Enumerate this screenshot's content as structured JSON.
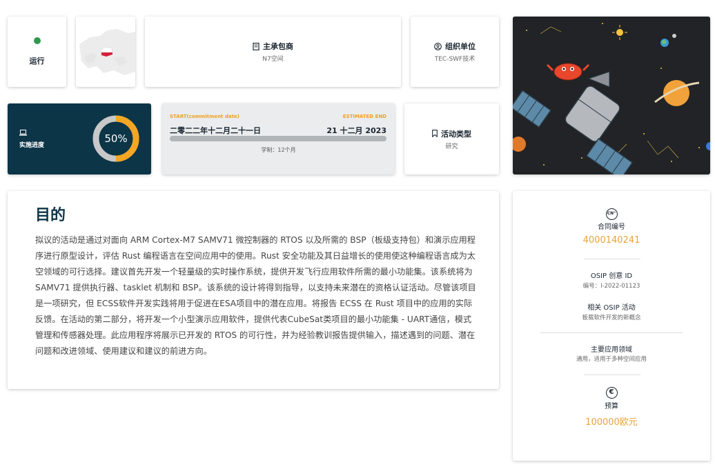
{
  "status": {
    "label": "运行",
    "color": "#2e9a4e"
  },
  "contractor": {
    "title": "主承包商",
    "value": "N7空间",
    "icon": "building-icon"
  },
  "organization": {
    "title": "组织单位",
    "value": "TEC-SWF技术",
    "icon": "user-circle-icon"
  },
  "progress": {
    "label": "实施进度",
    "percent": 50,
    "percent_text": "50%",
    "icon": "laptop-icon",
    "fill_color": "#f5a623",
    "track_color": "#c8c8c8"
  },
  "dates": {
    "start_label": "START(commitment date)",
    "start_value": "二零二二年十二月二十一日",
    "end_label": "ESTIMATED END",
    "end_value": "21 十二月 2023",
    "duration": "学制：12个月"
  },
  "activity_type": {
    "title": "活动类型",
    "value": "研究",
    "icon": "bookmark-icon"
  },
  "purpose": {
    "title": "目的",
    "body": "拟议的活动是通过对面向 ARM Cortex-M7 SAMV71 微控制器的 RTOS 以及所需的 BSP（板级支持包）和演示应用程序进行原型设计，评估 Rust 编程语言在空间应用中的使用。Rust 安全功能及其日益增长的使用使这种编程语言成为太空领域的可行选择。建议首先开发一个轻量级的实时操作系统，提供开发飞行应用软件所需的最小功能集。该系统将为 SAMV71 提供执行器、tasklet 机制和 BSP。该系统的设计将得到指导，以支持未来潜在的资格认证活动。尽管该项目是一项研究，但 ECSS软件开发实践将用于促进在ESA项目中的潜在应用。将报告 ECSS 在 Rust 项目中的应用的实际反馈。在活动的第二部分，将开发一个小型演示应用软件，提供代表CubeSat类项目的最小功能集 - UART通信，模式管理和传感器处理。此应用程序将展示已开发的 RTOS 的可行性，并为经验教训报告提供输入，描述遇到的问题、潜在问题和改进领域、使用建议和建议的前进方向。"
  },
  "sidebar": {
    "contract_icon": "CN°",
    "contract_title": "合同编号",
    "contract_value": "4000140241",
    "osip_title": "OSIP 创意 ID",
    "osip_sub": "编号：I-2022-01123",
    "related_title": "相关 OSIP 活动",
    "related_sub": "板载软件开发的新概念",
    "domain_title": "主要应用领域",
    "domain_sub": "通用，适用于多种空间应用",
    "budget_icon": "€",
    "budget_title": "预算",
    "budget_value": "100000欧元"
  },
  "colors": {
    "accent": "#e8a33a",
    "dark": "#0c3547",
    "status_green": "#2e9a4e"
  }
}
